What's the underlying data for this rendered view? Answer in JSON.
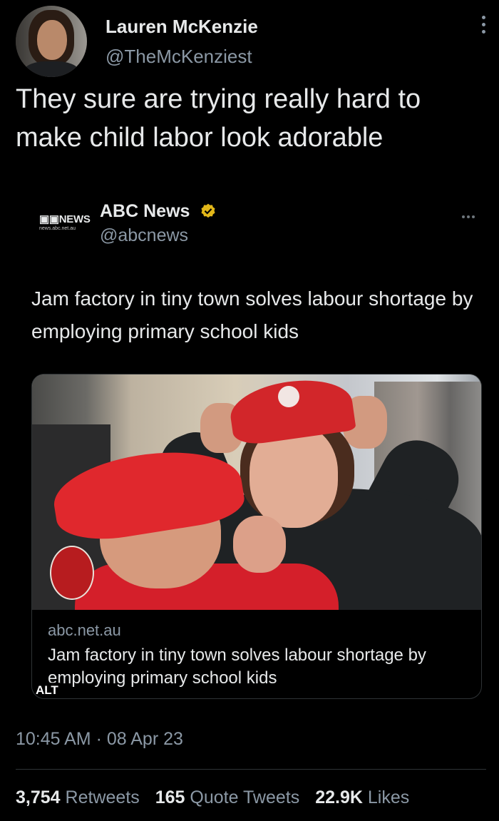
{
  "author": {
    "name": "Lauren McKenzie",
    "handle": "@TheMcKenziest"
  },
  "tweet": {
    "text": "They sure are trying really hard to make child labor look adorable"
  },
  "quoted": {
    "logo_line1": "NEWS",
    "logo_line2": "news.abc.net.au",
    "name": "ABC News",
    "handle": "@abcnews",
    "text": "Jam factory in tiny town solves labour shortage by employing primary school kids"
  },
  "card": {
    "domain": "abc.net.au",
    "title": "Jam factory in tiny town solves labour shortage by employing primary school kids",
    "alt_label": "ALT"
  },
  "meta": {
    "time": "10:45 AM",
    "separator": "·",
    "date": "08 Apr 23"
  },
  "stats": {
    "retweets_count": "3,754",
    "retweets_label": "Retweets",
    "quotes_count": "165",
    "quotes_label": "Quote Tweets",
    "likes_count": "22.9K",
    "likes_label": "Likes"
  },
  "colors": {
    "background": "#000000",
    "text_primary": "#e7e9ea",
    "text_secondary": "#8b98a5",
    "verified": "#e2b719",
    "divider": "#2f3336"
  }
}
